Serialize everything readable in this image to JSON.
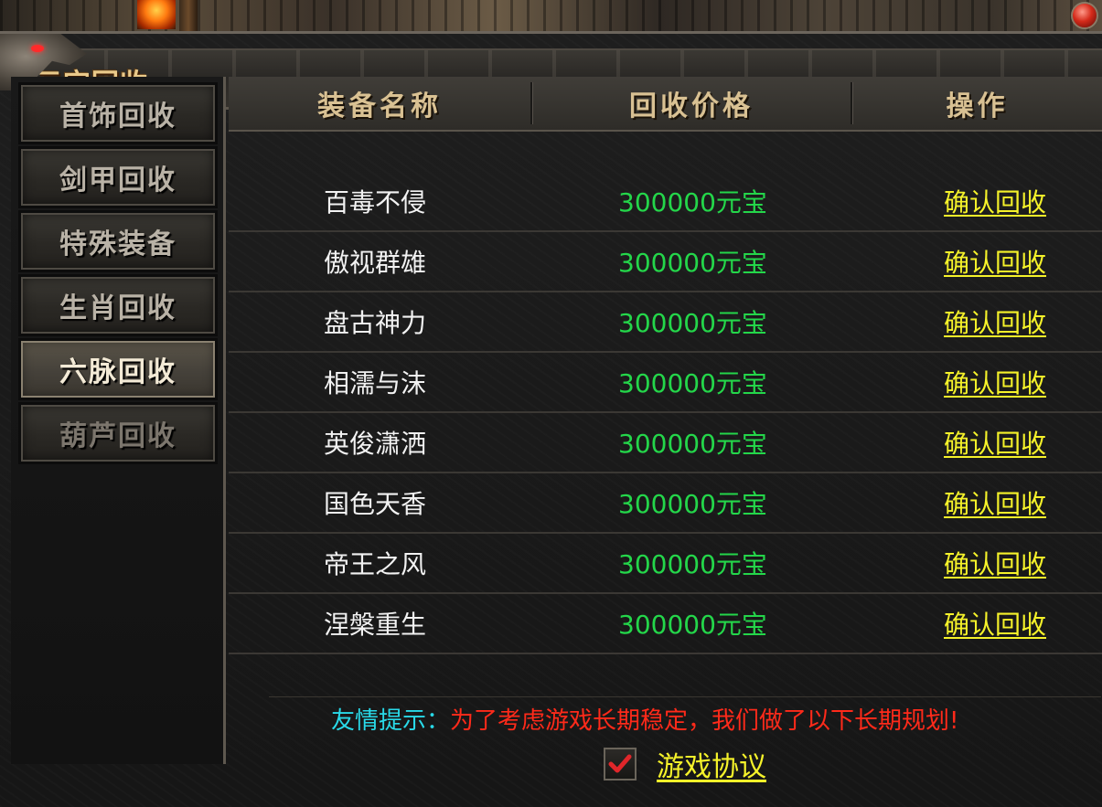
{
  "window": {
    "title": "元宝回收"
  },
  "sidebar": {
    "items": [
      {
        "label": "首饰回收",
        "state": "normal"
      },
      {
        "label": "剑甲回收",
        "state": "normal"
      },
      {
        "label": "特殊装备",
        "state": "normal"
      },
      {
        "label": "生肖回收",
        "state": "normal"
      },
      {
        "label": "六脉回收",
        "state": "active"
      },
      {
        "label": "葫芦回收",
        "state": "dim"
      }
    ]
  },
  "table": {
    "headers": {
      "name": "装备名称",
      "price": "回收价格",
      "operation": "操作"
    },
    "rows": [
      {
        "name": "百毒不侵",
        "price": "300000元宝",
        "action": "确认回收"
      },
      {
        "name": "傲视群雄",
        "price": "300000元宝",
        "action": "确认回收"
      },
      {
        "name": "盘古神力",
        "price": "300000元宝",
        "action": "确认回收"
      },
      {
        "name": "相濡与沫",
        "price": "300000元宝",
        "action": "确认回收"
      },
      {
        "name": "英俊潇洒",
        "price": "300000元宝",
        "action": "确认回收"
      },
      {
        "name": "国色天香",
        "price": "300000元宝",
        "action": "确认回收"
      },
      {
        "name": "帝王之风",
        "price": "300000元宝",
        "action": "确认回收"
      },
      {
        "name": "涅槃重生",
        "price": "300000元宝",
        "action": "确认回收"
      }
    ]
  },
  "tip": {
    "label": "友情提示：",
    "text": "为了考虑游戏长期稳定，我们做了以下长期规划!"
  },
  "agreement": {
    "checked": true,
    "label": "游戏协议"
  },
  "colors": {
    "price_green": "#24d64a",
    "action_yellow": "#f5f22a",
    "tip_cyan": "#29d9e8",
    "tip_red": "#ff2a1a",
    "title_gold": "#e9c98a",
    "check_red": "#e0262a"
  },
  "icons": {
    "checkbox": "checkmark-icon",
    "corner": "dragon-ornament-icon",
    "corner_right": "red-gem-icon"
  }
}
